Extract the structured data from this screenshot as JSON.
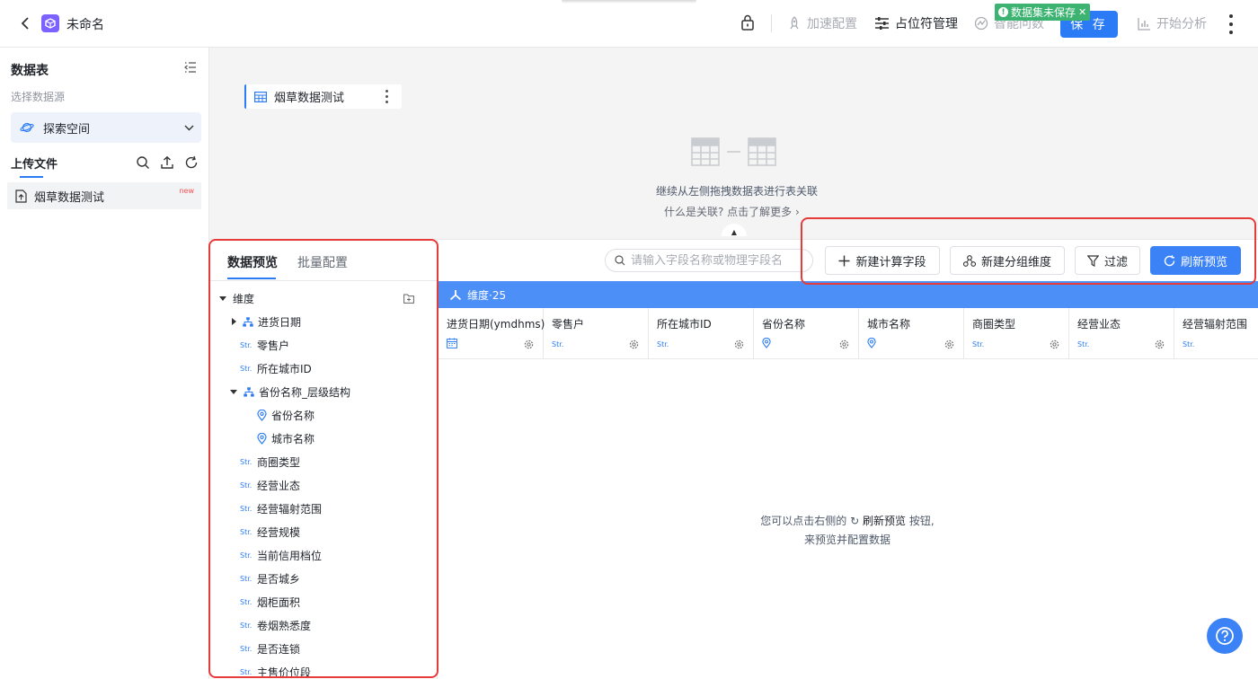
{
  "header": {
    "title": "未命名",
    "accelerate_label": "加速配置",
    "placeholder_mgmt_label": "占位符管理",
    "smart_qa_label": "智能问数",
    "save_label": "保 存",
    "unsaved_badge": "数据集未保存",
    "start_analysis_label": "开始分析"
  },
  "sidebar": {
    "title": "数据表",
    "subtitle": "选择数据源",
    "datasource": "探索空间",
    "upload_label": "上传文件",
    "files": [
      {
        "name": "烟草数据测试",
        "badge": "new"
      }
    ]
  },
  "canvas": {
    "table_chip": "烟草数据测试",
    "join_hint": "继续从左侧拖拽数据表进行表关联",
    "join_link": "什么是关联? 点击了解更多"
  },
  "preview": {
    "tabs": [
      "数据预览",
      "批量配置"
    ],
    "search_placeholder": "请输入字段名称或物理字段名",
    "buttons": {
      "new_calc": "新建计算字段",
      "new_group": "新建分组维度",
      "filter": "过滤",
      "refresh": "刷新预览"
    },
    "dimension_bar": "维度·25",
    "tree": {
      "root": "维度",
      "type_tag": "Str.",
      "items": [
        {
          "label": "进货日期",
          "kind": "hier-collapsed"
        },
        {
          "label": "零售户",
          "kind": "str"
        },
        {
          "label": "所在城市ID",
          "kind": "str"
        },
        {
          "label": "省份名称_层级结构",
          "kind": "hier-expanded"
        },
        {
          "label": "省份名称",
          "kind": "geo"
        },
        {
          "label": "城市名称",
          "kind": "geo"
        },
        {
          "label": "商圈类型",
          "kind": "str"
        },
        {
          "label": "经营业态",
          "kind": "str"
        },
        {
          "label": "经营辐射范围",
          "kind": "str"
        },
        {
          "label": "经营规模",
          "kind": "str"
        },
        {
          "label": "当前信用档位",
          "kind": "str"
        },
        {
          "label": "是否城乡",
          "kind": "str"
        },
        {
          "label": "烟柜面积",
          "kind": "str"
        },
        {
          "label": "卷烟熟悉度",
          "kind": "str"
        },
        {
          "label": "是否连锁",
          "kind": "str"
        },
        {
          "label": "主售价位段",
          "kind": "str"
        }
      ]
    },
    "columns": [
      {
        "name": "进货日期(ymdhms)",
        "type": "date"
      },
      {
        "name": "零售户",
        "type": "Str."
      },
      {
        "name": "所在城市ID",
        "type": "Str."
      },
      {
        "name": "省份名称",
        "type": "geo"
      },
      {
        "name": "城市名称",
        "type": "geo"
      },
      {
        "name": "商圈类型",
        "type": "Str."
      },
      {
        "name": "经营业态",
        "type": "Str."
      },
      {
        "name": "经营辐射范围",
        "type": "Str."
      }
    ],
    "empty_hint_pre": "您可以点击右侧的",
    "empty_hint_btn": "刷新预览",
    "empty_hint_post": "按钮,",
    "empty_hint_line2": "来预览并配置数据"
  },
  "colors": {
    "accent": "#2a7bf5",
    "unsaved": "#3cb371",
    "annotation": "#e63b3b"
  }
}
